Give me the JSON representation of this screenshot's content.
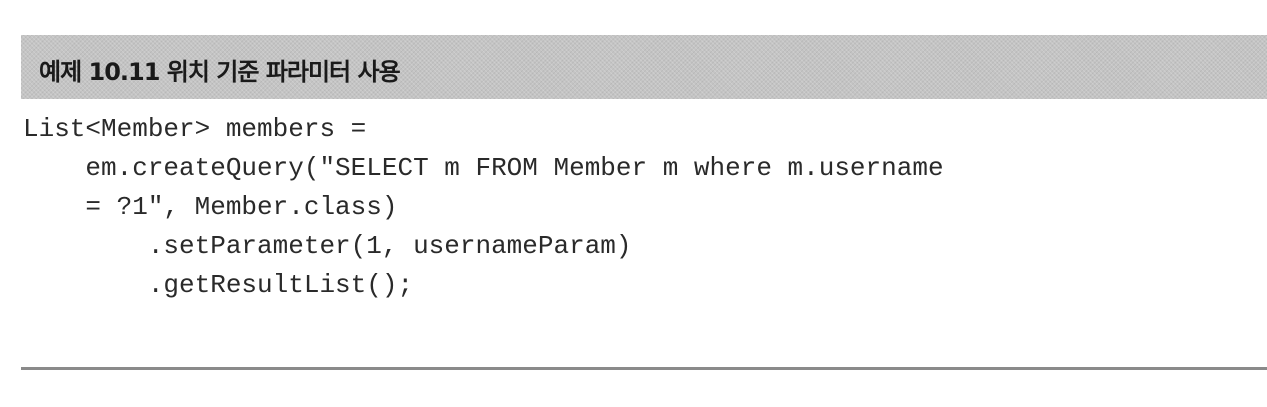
{
  "example": {
    "title": "예제 10.11 위치 기준 파라미터 사용"
  },
  "code": {
    "lines": [
      "List<Member> members =",
      "    em.createQuery(\"SELECT m FROM Member m where m.username",
      "    = ?1\", Member.class)",
      "        .setParameter(1, usernameParam)",
      "        .getResultList();"
    ]
  },
  "colors": {
    "header_band": "#c4c4c4",
    "text": "#2a2a2a",
    "rule": "#8a8a8a"
  }
}
